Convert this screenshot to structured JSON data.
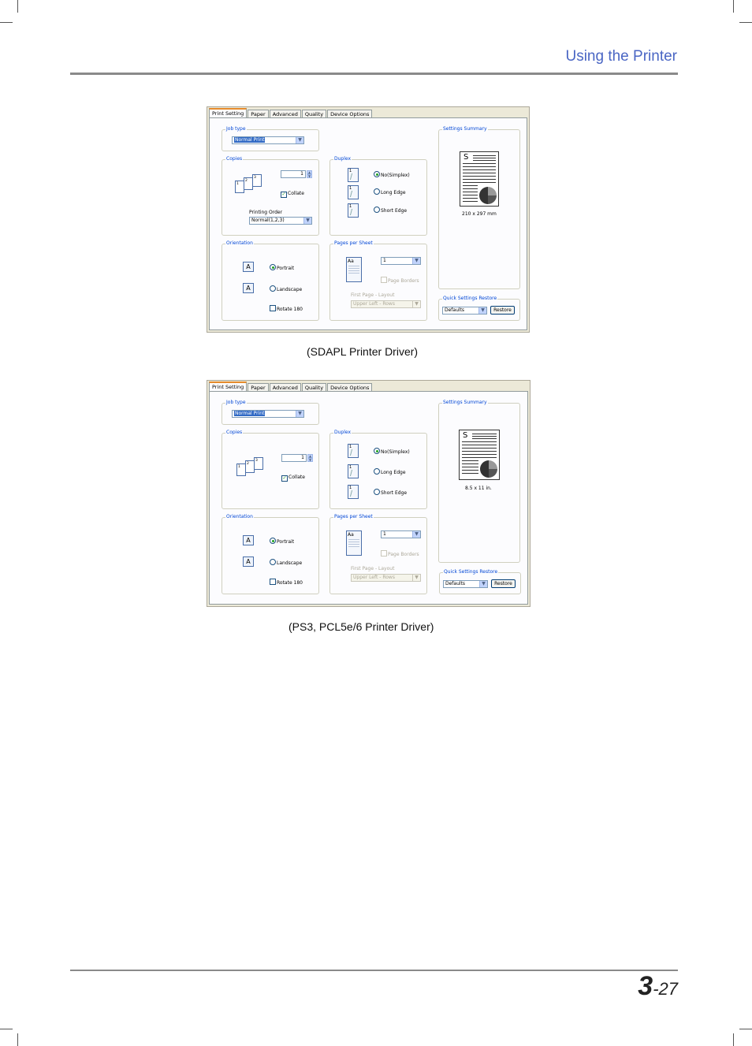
{
  "header": {
    "title": "Using the Printer"
  },
  "dialogs": [
    {
      "tabs": [
        "Print Setting",
        "Paper",
        "Advanced",
        "Quality",
        "Device Options"
      ],
      "job_type": {
        "title": "Job type",
        "value": "Normal Print"
      },
      "copies": {
        "title": "Copies",
        "value": "1",
        "collate": "Collate",
        "pages": [
          "1",
          "2",
          "3"
        ],
        "order_label": "Printing Order",
        "order_value": "Normal(1,2,3)"
      },
      "duplex": {
        "title": "Duplex",
        "options": [
          "No(Simplex)",
          "Long Edge",
          "Short Edge"
        ],
        "icon_pages": [
          "1",
          "1",
          "1"
        ]
      },
      "orientation": {
        "title": "Orientation",
        "icon_letter": "A",
        "options": [
          "Portrait",
          "Landscape"
        ],
        "rotate": "Rotate 180"
      },
      "pages_per_sheet": {
        "title": "Pages per Sheet",
        "value": "1",
        "page_borders": "Page Borders",
        "icon_text": "Aa",
        "layout_label": "First Page - Layout",
        "layout_value": "Upper Left - Rows"
      },
      "summary": {
        "title": "Settings Summary",
        "letter": "S",
        "size": "210 x 297 mm"
      },
      "quick": {
        "title": "Quick Settings Restore",
        "value": "Defaults",
        "restore": "Restore"
      }
    },
    {
      "tabs": [
        "Print Setting",
        "Paper",
        "Advanced",
        "Quality",
        "Device Options"
      ],
      "job_type": {
        "title": "Job type",
        "value": "Normal Print"
      },
      "copies": {
        "title": "Copies",
        "value": "1",
        "collate": "Collate",
        "pages": [
          "1",
          "2",
          "3"
        ]
      },
      "duplex": {
        "title": "Duplex",
        "options": [
          "No(Simplex)",
          "Long Edge",
          "Short Edge"
        ],
        "icon_pages": [
          "1",
          "1",
          "1"
        ]
      },
      "orientation": {
        "title": "Orientation",
        "icon_letter": "A",
        "options": [
          "Portrait",
          "Landscape"
        ],
        "rotate": "Rotate 180"
      },
      "pages_per_sheet": {
        "title": "Pages per Sheet",
        "value": "1",
        "page_borders": "Page Borders",
        "icon_text": "Aa",
        "layout_label": "First Page - Layout",
        "layout_value": "Upper Left - Rows"
      },
      "summary": {
        "title": "Settings Summary",
        "letter": "S",
        "size": "8.5 x 11 in."
      },
      "quick": {
        "title": "Quick Settings Restore",
        "value": "Defaults",
        "restore": "Restore"
      }
    }
  ],
  "captions": [
    "(SDAPL  Printer Driver)",
    "(PS3, PCL5e/6  Printer Driver)"
  ],
  "footer": {
    "chapter": "3",
    "page": "-27"
  },
  "colors": {
    "header_text": "#4a66c4",
    "accent_tab": "#e68b2c",
    "group_title": "#0046d5",
    "selection": "#316ac5"
  }
}
